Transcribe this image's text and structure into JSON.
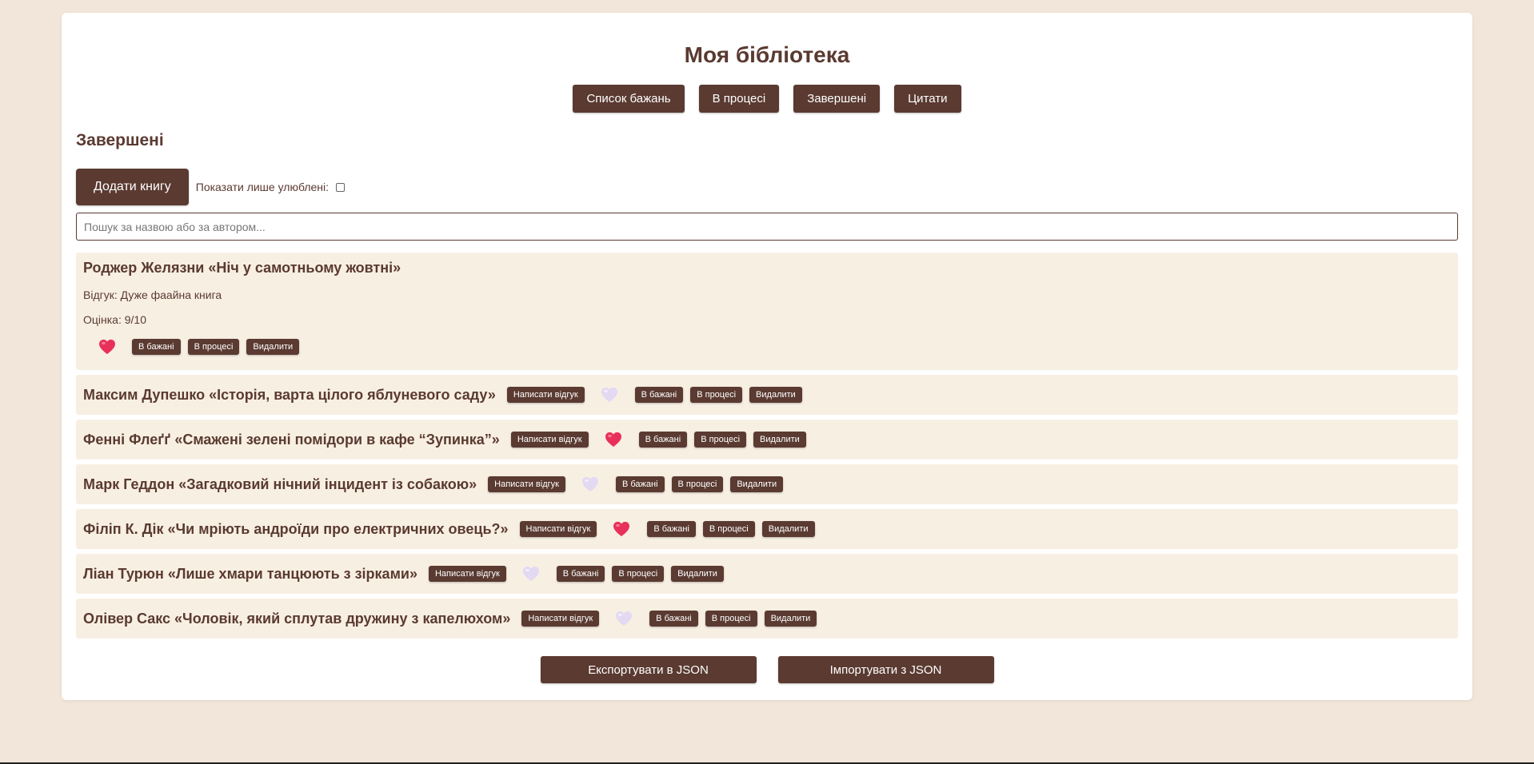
{
  "header": {
    "title": "Моя бібліотека"
  },
  "tabs": [
    {
      "label": "Список бажань"
    },
    {
      "label": "В процесі"
    },
    {
      "label": "Завершені"
    },
    {
      "label": "Цитати"
    }
  ],
  "section": {
    "title": "Завершені"
  },
  "controls": {
    "add_label": "Додати книгу",
    "favorites_label": "Показати лише улюблені:",
    "favorites_checked": false
  },
  "search": {
    "placeholder": "Пошук за назвою або за автором..."
  },
  "actions": {
    "review": "Написати відгук",
    "to_wishlist": "В бажані",
    "to_progress": "В процесі",
    "delete": "Видалити"
  },
  "expanded_book": {
    "title": "Роджер Желязни «Ніч у самотньому жовтні»",
    "review": "Відгук: Дуже фаайна книга",
    "rating": "Оцінка: 9/10",
    "favorite": true
  },
  "books": [
    {
      "title": "Максим Дупешко «Історія, варта цілого яблуневого саду»",
      "favorite": false
    },
    {
      "title": "Фенні Флеґґ «Смажені зелені помідори в кафе “Зупинка”»",
      "favorite": true
    },
    {
      "title": "Марк Геддон «Загадковий нічний інцидент із собакою»",
      "favorite": false
    },
    {
      "title": "Філіп К. Дік «Чи мріють андроїди про електричних овець?»",
      "favorite": true
    },
    {
      "title": "Ліан Турюн «Лише хмари танцюють з зірками»",
      "favorite": false
    },
    {
      "title": "Олівер Сакс «Чоловік, який сплутав дружину з капелюхом»",
      "favorite": false
    }
  ],
  "footer": {
    "export_label": "Експортувати в JSON",
    "import_label": "Імпортувати з JSON"
  },
  "colors": {
    "background": "#f2e6da",
    "card": "#ffffff",
    "accent": "#5a3a31",
    "book_bg": "#f8efe3",
    "heart_active": "#e8315a",
    "heart_inactive": "#e3d9f3"
  }
}
